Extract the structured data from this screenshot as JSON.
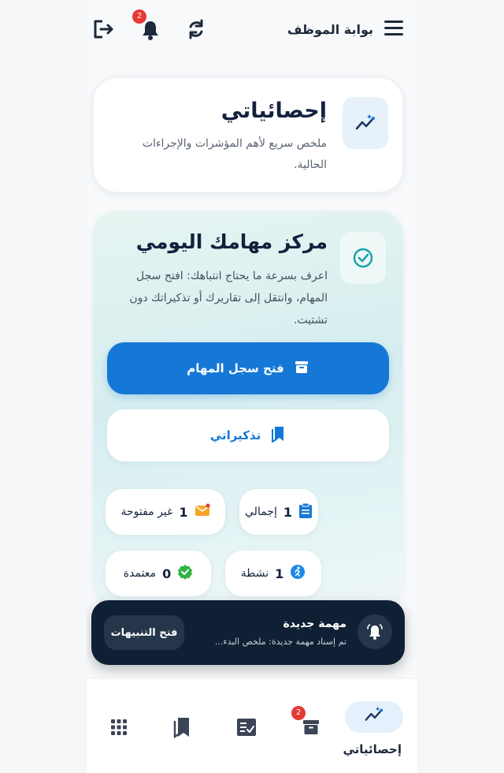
{
  "header": {
    "title": "بوابة الموظف",
    "notification_count": "2",
    "icons": [
      "menu-icon",
      "refresh-icon",
      "bell-icon",
      "logout-icon"
    ]
  },
  "stats_card": {
    "title": "إحصائياتي",
    "description": "ملخص سريع لأهم المؤشرات والإجراءات الحالية."
  },
  "tasks_card": {
    "title": "مركز مهامك اليومي",
    "description": "اعرف بسرعة ما يحتاج انتباهك: افتح سجل المهام، وانتقل إلى تقاريرك أو تذكيراتك دون تشتيت.",
    "primary_button": "فتح سجل المهام",
    "secondary_button": "تذكيراتي",
    "chips": [
      {
        "label": "إجمالي",
        "value": "1",
        "icon": "clipboard-icon"
      },
      {
        "label": "غير مفتوحة",
        "value": "1",
        "icon": "envelope-icon"
      },
      {
        "label": "نشطة",
        "value": "1",
        "icon": "running-icon"
      },
      {
        "label": "معتمدة",
        "value": "0",
        "icon": "verified-icon"
      }
    ]
  },
  "toast": {
    "title": "مهمة جديدة",
    "message": "تم إسناد مهمة جديدة: ملخص البدء...",
    "action": "فتح التنبيهات"
  },
  "bottom_nav": {
    "active_label": "إحصائياتي",
    "archive_badge": "2",
    "items": [
      "stats-icon",
      "archive-icon",
      "checklist-icon",
      "bookmarks-icon",
      "apps-grid-icon"
    ]
  },
  "colors": {
    "primary": "#1678d6",
    "dark": "#0f2034",
    "badge": "#e53935"
  }
}
